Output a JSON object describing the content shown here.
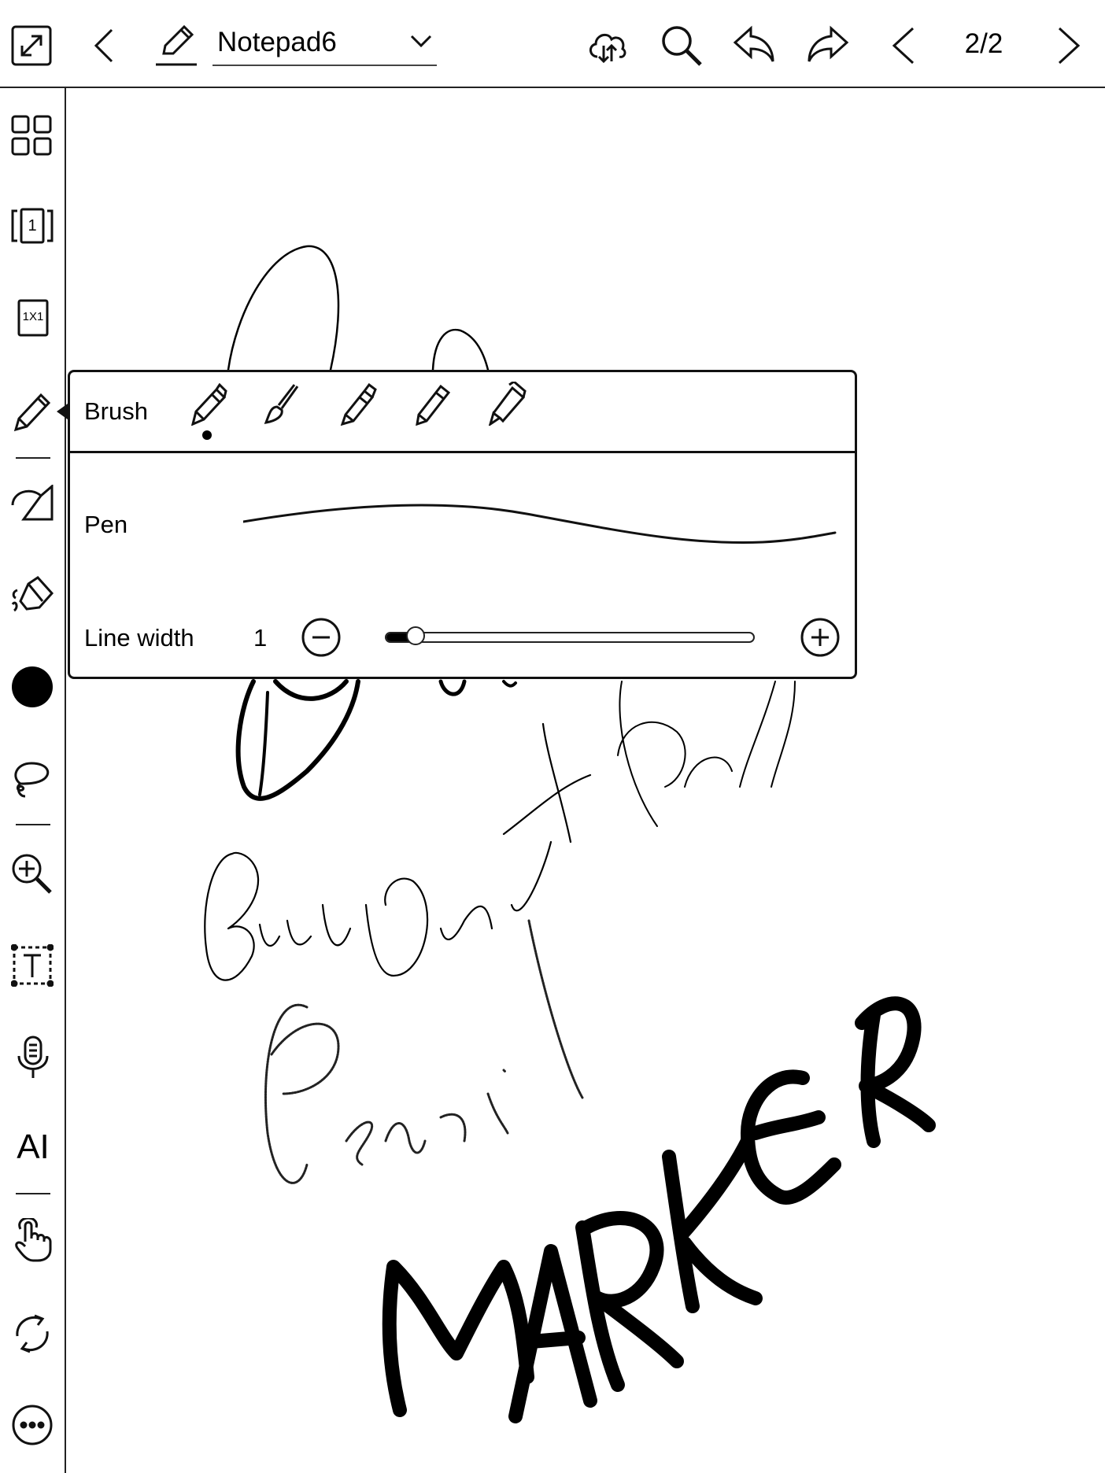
{
  "header": {
    "notebook_title": "Notepad6",
    "page_indicator": "2/2"
  },
  "sidebar": {
    "page_num_icon_text": "1",
    "layout_icon_text": "1X1",
    "ai_label": "AI",
    "current_color": "#000000"
  },
  "brush_panel": {
    "brush_label": "Brush",
    "brush_types": [
      "fountain-pen",
      "brush",
      "ballpoint-pen",
      "pencil",
      "marker"
    ],
    "selected_brush_index": 0,
    "pen_label": "Pen",
    "line_width_label": "Line width",
    "line_width_value": "1",
    "line_width_level_fraction": 0.08
  }
}
